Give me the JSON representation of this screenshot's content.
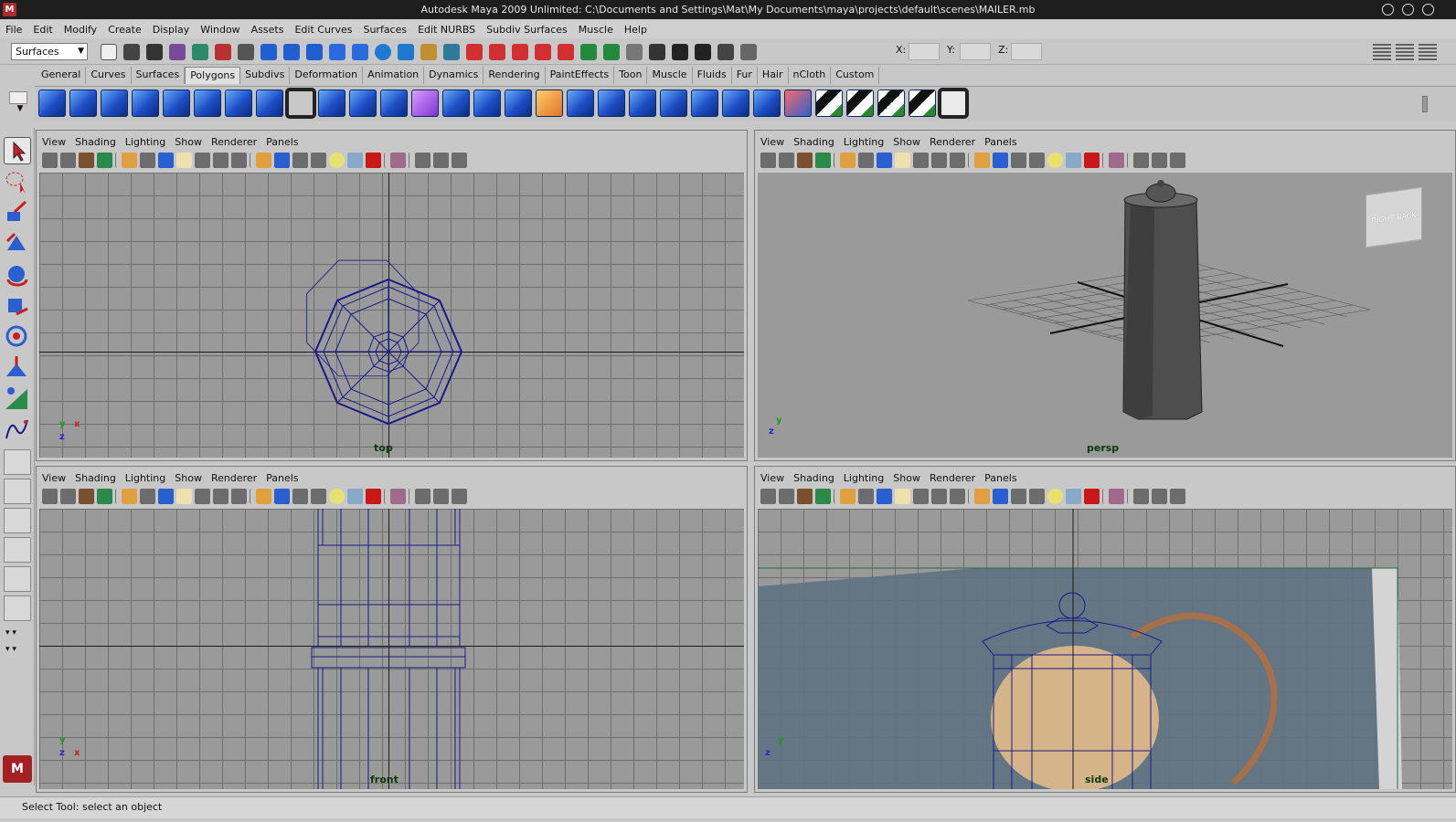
{
  "window": {
    "title": "Autodesk Maya 2009 Unlimited: C:\\Documents and Settings\\Mat\\My Documents\\maya\\projects\\default\\scenes\\MAILER.mb",
    "app_icon": "M"
  },
  "menubar": {
    "items": [
      "File",
      "Edit",
      "Modify",
      "Create",
      "Display",
      "Window",
      "Assets",
      "Edit Curves",
      "Surfaces",
      "Edit NURBS",
      "Subdiv Surfaces",
      "Muscle",
      "Help"
    ]
  },
  "statusline": {
    "mode_value": "Surfaces",
    "x_label": "X:",
    "y_label": "Y:",
    "z_label": "Z:"
  },
  "shelf": {
    "tabs": [
      "General",
      "Curves",
      "Surfaces",
      "Polygons",
      "Subdivs",
      "Deformation",
      "Animation",
      "Dynamics",
      "Rendering",
      "PaintEffects",
      "Toon",
      "Muscle",
      "Fluids",
      "Fur",
      "Hair",
      "nCloth",
      "Custom"
    ],
    "active_tab": "Polygons"
  },
  "panel_menu": {
    "view": "View",
    "shading": "Shading",
    "lighting": "Lighting",
    "show": "Show",
    "renderer": "Renderer",
    "panels": "Panels"
  },
  "viewports": {
    "top": {
      "label": "top"
    },
    "persp": {
      "label": "persp",
      "viewcube_text": "RIGHT BACK"
    },
    "front": {
      "label": "front"
    },
    "side": {
      "label": "side"
    }
  },
  "axes": {
    "x": "x",
    "y": "y",
    "z": "z"
  },
  "helpline": {
    "text": "Select Tool: select an object"
  },
  "colors": {
    "wire": "#1a1a8a",
    "grid": "#6f6f6f",
    "viewport_bg": "#9a9a9a",
    "ui_bg": "#c8c8c8"
  }
}
